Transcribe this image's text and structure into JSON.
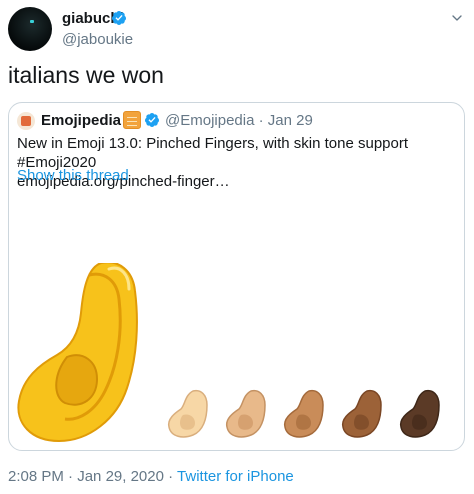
{
  "author": {
    "display_name": "giabuchi",
    "handle": "@jaboukie",
    "verified": true,
    "avatar_icon": "avatar-dark-space-icon"
  },
  "tweet": {
    "text": "italians we won"
  },
  "quoted_tweet": {
    "display_name": "Emojipedia",
    "handle": "@Emojipedia",
    "separator": "·",
    "date": "Jan 29",
    "verified": true,
    "body_line1": "New in Emoji 13.0: Pinched Fingers, with skin tone support #Emoji2020",
    "body_line2": "emojipedia.org/pinched-finger…",
    "show_thread": "Show this thread",
    "media": {
      "description_icon": "pinched-fingers-emoji-icon",
      "skin_tones": [
        "#f7d7a6",
        "#e8b98a",
        "#c98c59",
        "#9c6238",
        "#5b3a26"
      ],
      "default_color": "#f7c21b"
    }
  },
  "footer": {
    "time": "2:08 PM",
    "sep1": "·",
    "date": "Jan 29, 2020",
    "sep2": "·",
    "source": "Twitter for iPhone"
  },
  "colors": {
    "text": "#14171a",
    "secondary": "#657786",
    "link": "#1b95e0",
    "verified": "#1da1f2",
    "border": "#ccd6dd"
  }
}
